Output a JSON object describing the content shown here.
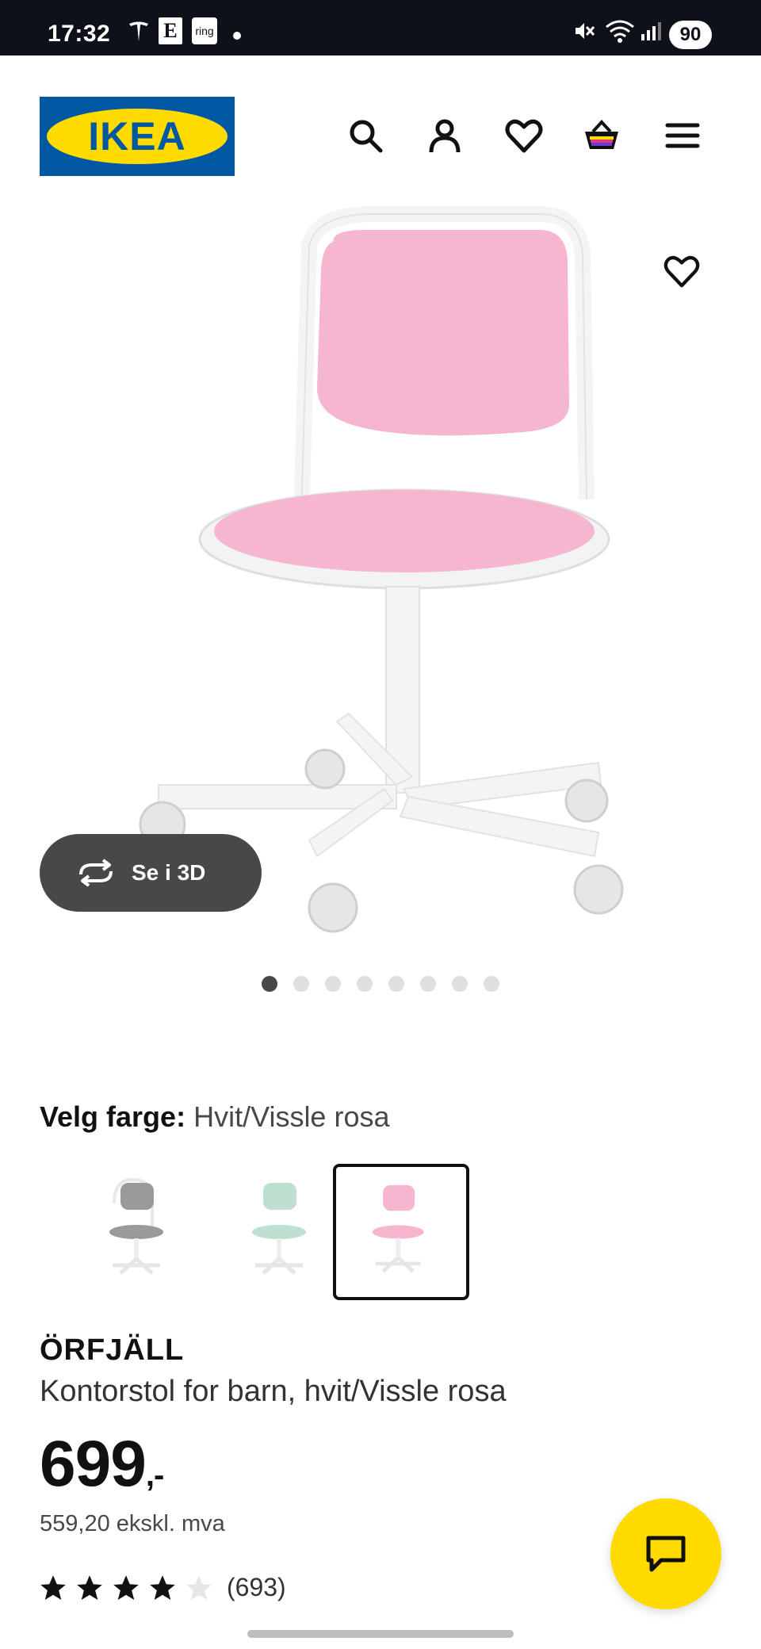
{
  "status_bar": {
    "time": "17:32",
    "icons": [
      "tesla-icon",
      "e-icon",
      "ring-icon",
      "dot-icon",
      "mute-icon",
      "wifi-icon",
      "signal-icon"
    ],
    "e_label": "E",
    "ring_label": "ring",
    "battery": "90"
  },
  "header": {
    "logo_text": "IKEA",
    "icons": [
      "search-icon",
      "account-icon",
      "heart-icon",
      "cart-icon",
      "menu-icon"
    ]
  },
  "gallery": {
    "view_3d_label": "Se i 3D",
    "dot_count": 8,
    "active_dot": 1
  },
  "color_selector": {
    "label": "Velg farge:",
    "value": "Hvit/Vissle rosa",
    "variants": [
      {
        "name": "grey",
        "seat_color": "#9a9a9a",
        "selected": false
      },
      {
        "name": "green",
        "seat_color": "#bfe0d0",
        "selected": false
      },
      {
        "name": "pink",
        "seat_color": "#f6b6cf",
        "selected": true
      }
    ]
  },
  "product": {
    "name": "ÖRFJÄLL",
    "description": "Kontorstol for barn, hvit/Vissle rosa",
    "price": "699",
    "price_suffix": ",-",
    "ex_vat": "559,20 ekskl. mva",
    "rating": 4,
    "rating_max": 5,
    "review_count": "(693)"
  },
  "colors": {
    "brand_blue": "#0058a3",
    "brand_yellow": "#ffdb00",
    "chair_pink": "#f6b6cf"
  }
}
